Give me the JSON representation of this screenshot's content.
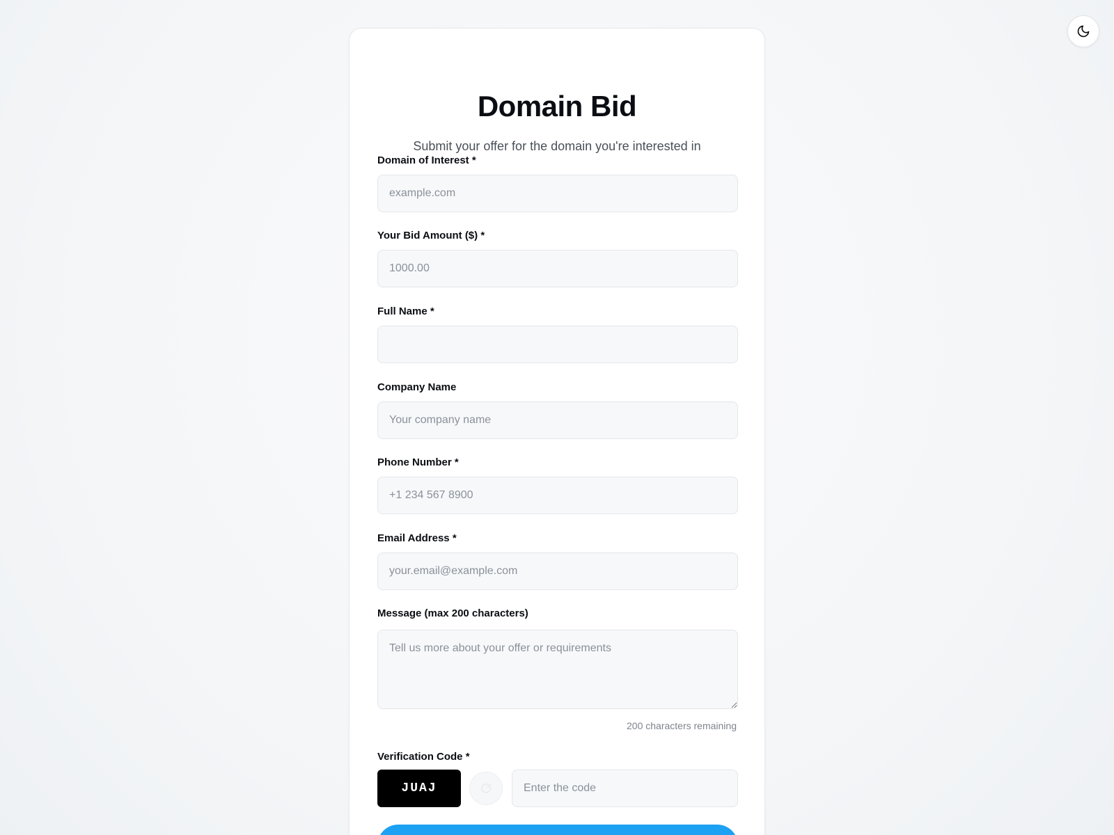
{
  "theme_toggle": {
    "icon": "moon-icon"
  },
  "header": {
    "title": "Domain Bid",
    "subtitle": "Submit your offer for the domain you're interested in"
  },
  "form": {
    "domain": {
      "label": "Domain of Interest *",
      "placeholder": "example.com",
      "value": ""
    },
    "bid": {
      "label": "Your Bid Amount ($) *",
      "placeholder": "1000.00",
      "value": ""
    },
    "full_name": {
      "label": "Full Name *",
      "placeholder": "",
      "value": ""
    },
    "company": {
      "label": "Company Name",
      "placeholder": "Your company name",
      "value": ""
    },
    "phone": {
      "label": "Phone Number *",
      "placeholder": "+1 234 567 8900",
      "value": ""
    },
    "email": {
      "label": "Email Address *",
      "placeholder": "your.email@example.com",
      "value": ""
    },
    "message": {
      "label": "Message (max 200 characters)",
      "placeholder": "Tell us more about your offer or requirements",
      "value": "",
      "counter": "200 characters remaining"
    },
    "verification": {
      "label": "Verification Code *",
      "captcha": "JUAJ",
      "refresh_icon": "refresh-icon",
      "placeholder": "Enter the code",
      "value": ""
    },
    "submit_label": ""
  },
  "colors": {
    "accent": "#1da1f2",
    "captcha_bg": "#000000",
    "field_bg": "#f7f8fa"
  }
}
